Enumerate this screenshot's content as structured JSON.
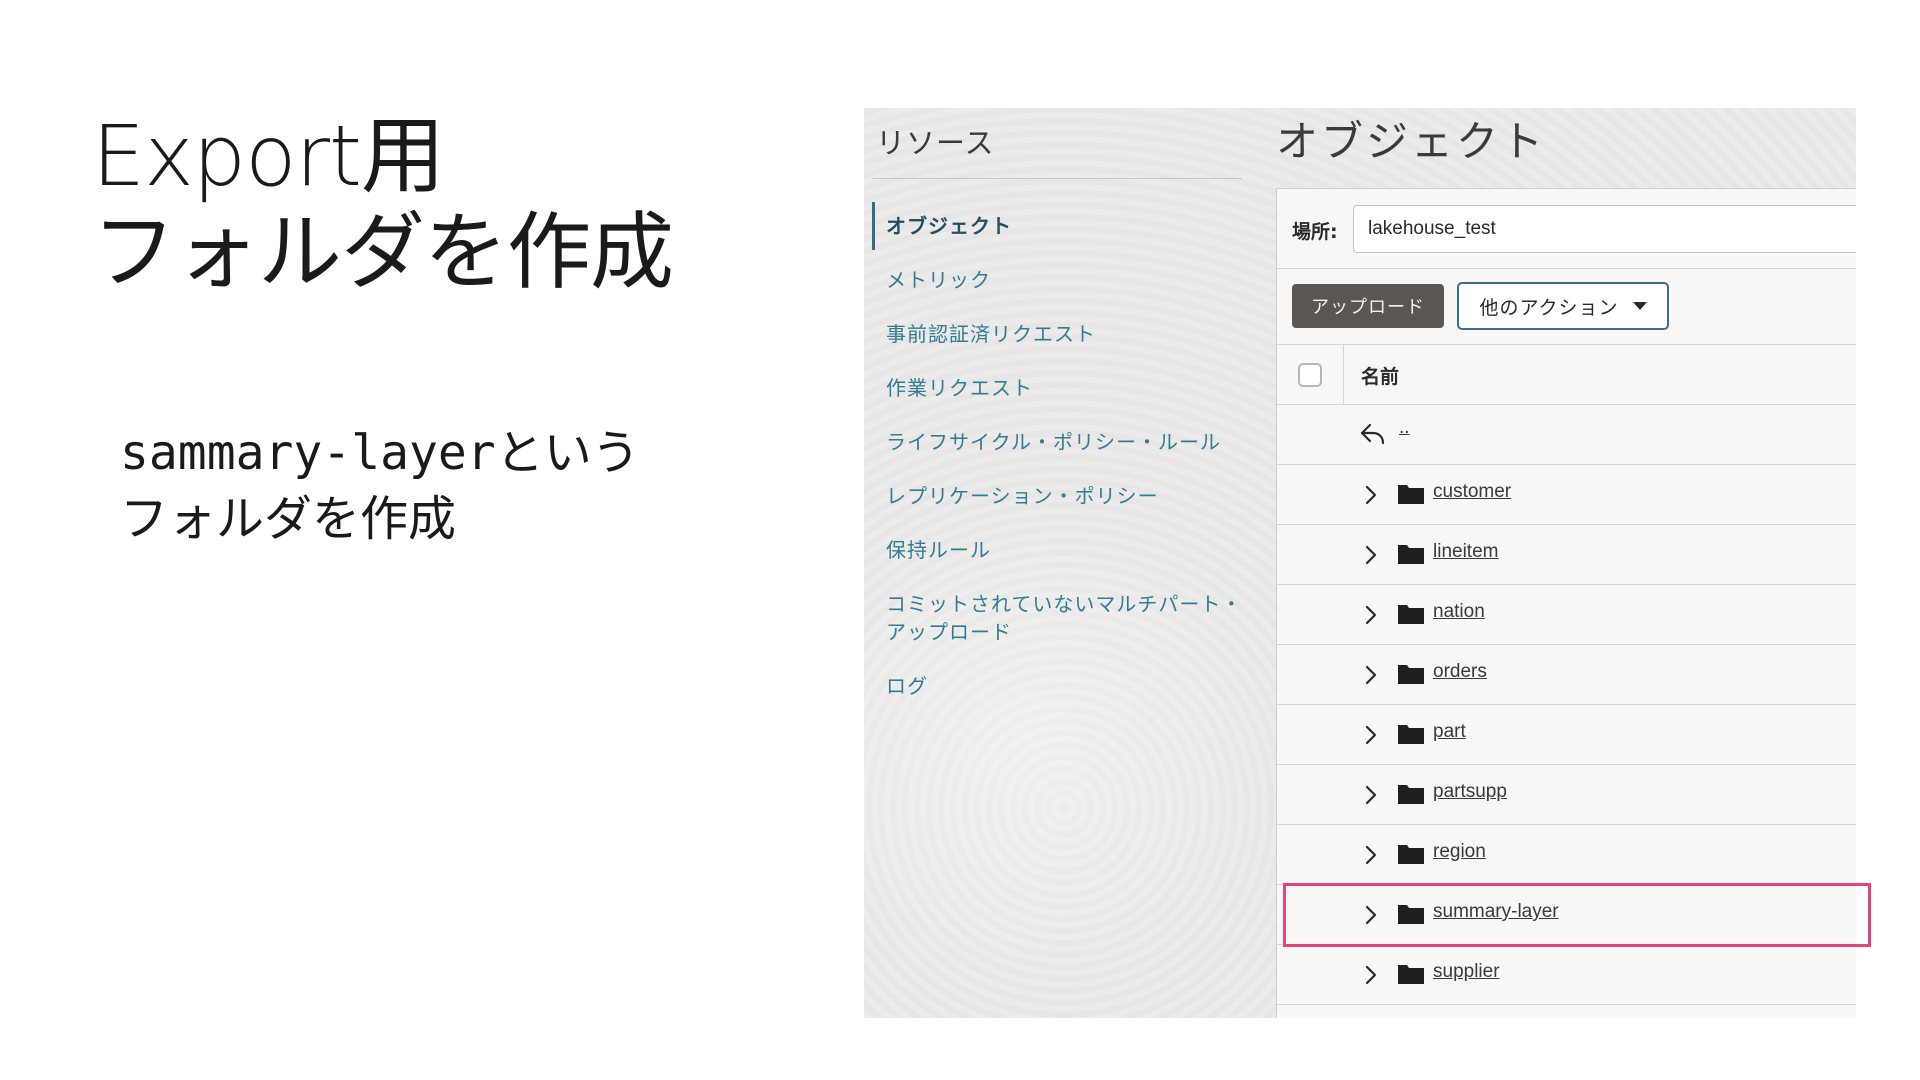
{
  "slide": {
    "title_line1": "Export用",
    "title_line2": "フォルダを作成",
    "body_code": "sammary-layer",
    "body_suffix": "という",
    "body_line2": "フォルダを作成"
  },
  "sidebar": {
    "title": "リソース",
    "items": [
      {
        "label": "オブジェクト",
        "active": true
      },
      {
        "label": "メトリック"
      },
      {
        "label": "事前認証済リクエスト"
      },
      {
        "label": "作業リクエスト"
      },
      {
        "label": "ライフサイクル・ポリシー・ルール"
      },
      {
        "label": "レプリケーション・ポリシー"
      },
      {
        "label": "保持ルール"
      },
      {
        "label": "コミットされていないマルチパート・アップロード"
      },
      {
        "label": "ログ"
      }
    ]
  },
  "main": {
    "title": "オブジェクト",
    "location_label": "場所:",
    "location_value": "lakehouse_test",
    "upload_label": "アップロード",
    "more_actions_label": "他のアクション",
    "column_name": "名前",
    "parent_link": "..",
    "folders": [
      "customer",
      "lineitem",
      "nation",
      "orders",
      "part",
      "partsupp",
      "region",
      "summary-layer",
      "supplier"
    ],
    "highlighted_folder": "summary-layer"
  },
  "icons": {
    "back": "back-arrow-icon",
    "expand": "chevron-right-icon",
    "folder": "folder-icon",
    "dropdown": "caret-down-icon"
  },
  "colors": {
    "highlight": "#e3457f",
    "link_teal": "#2e7d96",
    "upload_button": "#5b5651"
  }
}
